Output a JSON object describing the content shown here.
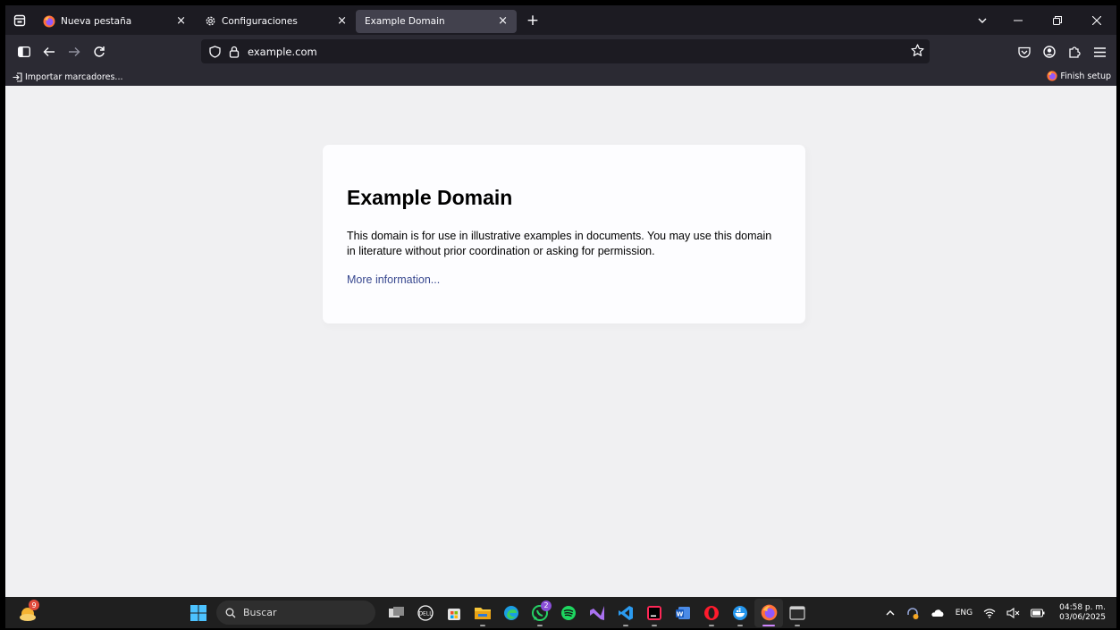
{
  "tabs": [
    {
      "label": "Nueva pestaña",
      "icon": "firefox-icon",
      "active": false
    },
    {
      "label": "Configuraciones",
      "icon": "gear-icon",
      "active": false
    },
    {
      "label": "Example Domain",
      "icon": "",
      "active": true
    }
  ],
  "tab_close_glyph": "×",
  "new_tab_glyph": "+",
  "urlbar": {
    "url": "example.com"
  },
  "bookmarks": {
    "import_label": "Importar marcadores...",
    "finish_setup_label": "Finish setup"
  },
  "page": {
    "title": "Example Domain",
    "paragraph": "This domain is for use in illustrative examples in documents. You may use this domain in literature without prior coordination or asking for permission.",
    "link": "More information..."
  },
  "taskbar": {
    "search_label": "Buscar",
    "widget_badge": "9",
    "whatsapp_badge": "2",
    "lang": "ENG",
    "time": "04:58 p. m.",
    "date": "03/06/2025"
  },
  "colors": {
    "tab_strip": "#1c1b22",
    "toolbar": "#2b2a33",
    "active_tab": "#42414d",
    "page_bg": "#f0f0f2",
    "card_bg": "#fdfdff",
    "link": "#38488f",
    "taskbar": "#1f1f1f"
  }
}
